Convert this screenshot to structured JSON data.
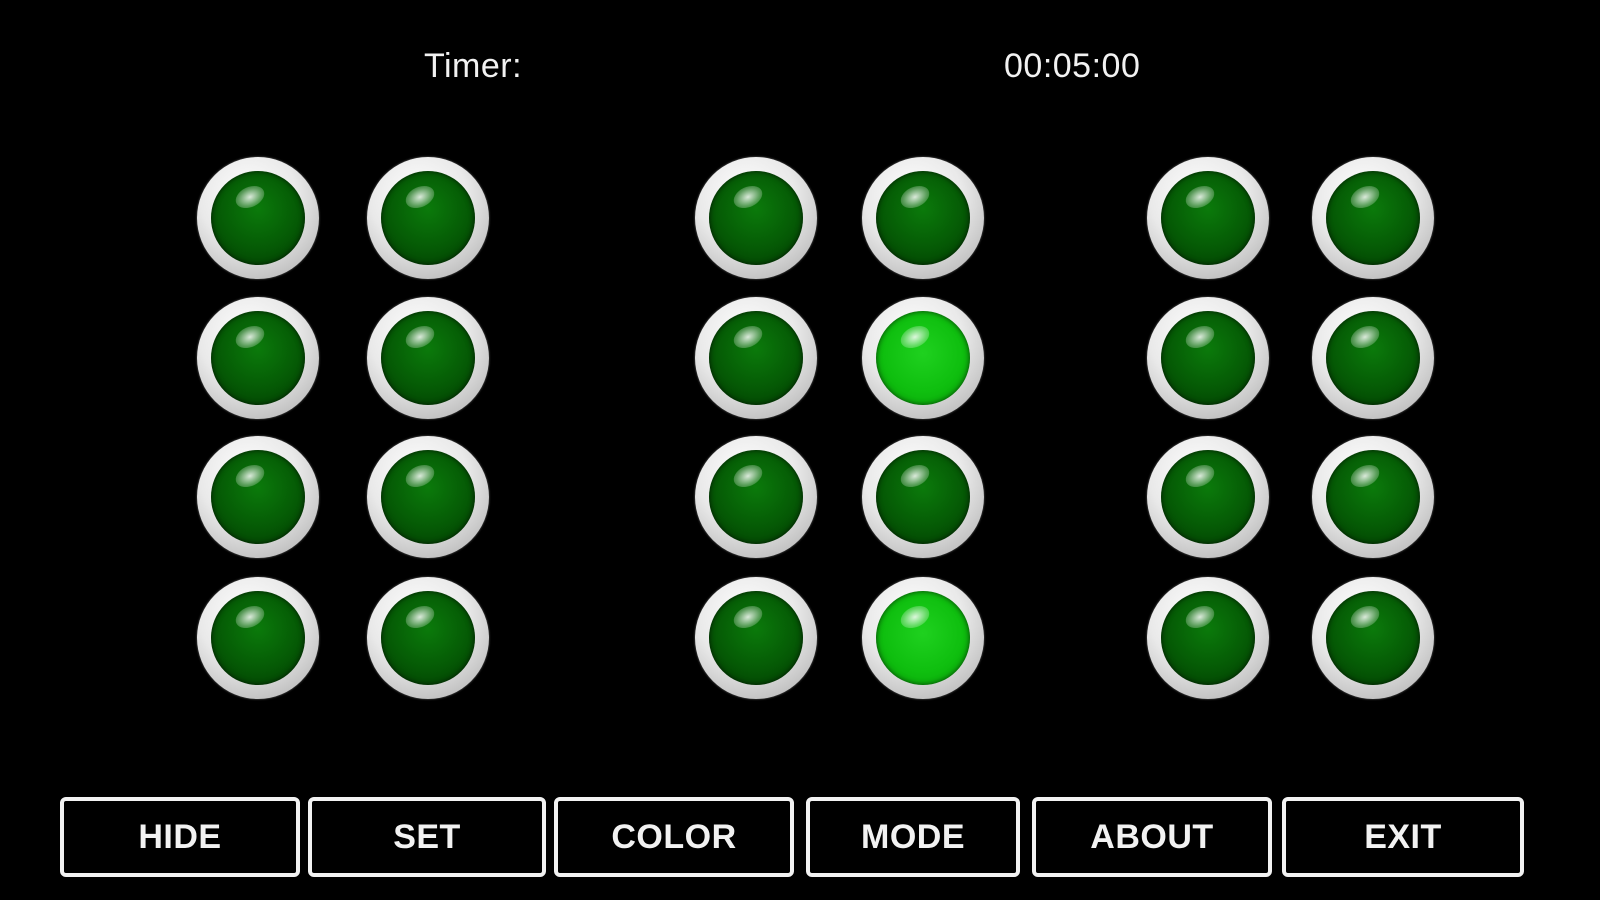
{
  "timer": {
    "label": "Timer:",
    "value": "00:05:00"
  },
  "colors": {
    "background": "#000000",
    "led_off": "#055a05",
    "led_on": "#12c412",
    "bezel": "#d9d9d9",
    "button_border": "#f2f2f2",
    "text": "#f2f2f2"
  },
  "led_groups": [
    {
      "name": "group-1",
      "columns": [
        [
          false,
          false,
          false,
          false
        ],
        [
          false,
          false,
          false,
          false
        ]
      ]
    },
    {
      "name": "group-2",
      "columns": [
        [
          false,
          false,
          false,
          false
        ],
        [
          false,
          true,
          false,
          true
        ]
      ]
    },
    {
      "name": "group-3",
      "columns": [
        [
          false,
          false,
          false,
          false
        ],
        [
          false,
          false,
          false,
          false
        ]
      ]
    }
  ],
  "buttons": {
    "hide": "HIDE",
    "set": "SET",
    "color": "COLOR",
    "mode": "MODE",
    "about": "ABOUT",
    "exit": "EXIT"
  }
}
